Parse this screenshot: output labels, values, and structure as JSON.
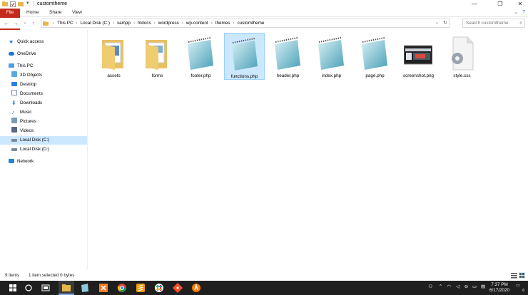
{
  "window": {
    "title": "customtheme",
    "controls": {
      "minimize": "—",
      "maximize": "❐",
      "close": "✕"
    }
  },
  "ribbon": {
    "tabs": [
      "File",
      "Home",
      "Share",
      "View"
    ],
    "help": "?"
  },
  "address": {
    "crumbs": [
      "This PC",
      "Local Disk (C:)",
      "xampp",
      "htdocs",
      "wordpress",
      "wp-content",
      "themes",
      "customtheme"
    ],
    "separator": "›",
    "search_placeholder": "Search customtheme"
  },
  "nav": {
    "items": [
      {
        "label": "Quick access",
        "icon": "star-icon",
        "color": "#3a7bd5"
      },
      {
        "label": "OneDrive",
        "icon": "cloud-icon",
        "color": "#1e73d8"
      },
      {
        "label": "This PC",
        "icon": "computer-icon",
        "color": "#4aa0e0"
      },
      {
        "label": "3D Objects",
        "icon": "cube-icon",
        "color": "#5aa8e0"
      },
      {
        "label": "Desktop",
        "icon": "desktop-icon",
        "color": "#2a82d8"
      },
      {
        "label": "Documents",
        "icon": "document-icon",
        "color": "#7a8aa0"
      },
      {
        "label": "Downloads",
        "icon": "download-icon",
        "color": "#2a82d8"
      },
      {
        "label": "Music",
        "icon": "music-icon",
        "color": "#2a82d8"
      },
      {
        "label": "Pictures",
        "icon": "picture-icon",
        "color": "#7a9ab0"
      },
      {
        "label": "Videos",
        "icon": "video-icon",
        "color": "#5a6a80"
      },
      {
        "label": "Local Disk (C:)",
        "icon": "drive-icon",
        "color": "#7a8a9a"
      },
      {
        "label": "Local Disk (D:)",
        "icon": "drive-icon",
        "color": "#7a8a9a"
      },
      {
        "label": "Network",
        "icon": "network-icon",
        "color": "#2a82d8"
      }
    ]
  },
  "files": [
    {
      "name": "assets",
      "kind": "folder"
    },
    {
      "name": "forms",
      "kind": "folder"
    },
    {
      "name": "footer.php",
      "kind": "notepad"
    },
    {
      "name": "functions.php",
      "kind": "notepad"
    },
    {
      "name": "header.php",
      "kind": "notepad"
    },
    {
      "name": "index.php",
      "kind": "notepad"
    },
    {
      "name": "page.php",
      "kind": "notepad"
    },
    {
      "name": "screenshot.png",
      "kind": "image"
    },
    {
      "name": "style.css",
      "kind": "settings"
    }
  ],
  "status": {
    "count": "9 items",
    "selection": "1 item selected  0 bytes"
  },
  "taskbar": {
    "apps": [
      "windows-start-icon",
      "search-icon",
      "task-view-icon",
      "file-explorer-icon",
      "notepad-icon",
      "xampp-icon",
      "chrome-icon",
      "sublime-icon",
      "slack-icon",
      "git-icon",
      "avast-icon"
    ],
    "clock_time": "7:37 PM",
    "clock_date": "6/17/2020",
    "notification_count": "6"
  }
}
